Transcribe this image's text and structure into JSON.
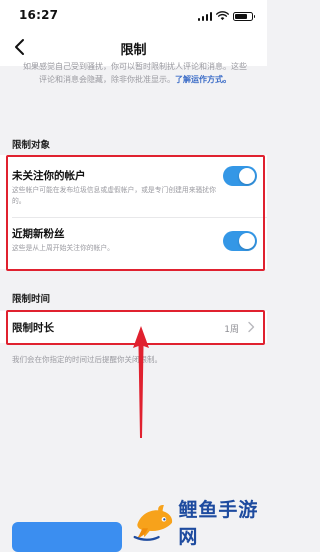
{
  "status_bar": {
    "time": "16:27"
  },
  "nav": {
    "title": "限制"
  },
  "intro": {
    "text": "如果感觉自己受到骚扰，你可以暂时限制扰人评论和消息。这些评论和消息会隐藏，除非你批准显示。",
    "link": "了解运作方式。"
  },
  "section_restrict_targets": {
    "header": "限制对象",
    "items": [
      {
        "title": "未关注你的帐户",
        "desc": "这些帐户可能在发布垃圾信息或虚假帐户，或是专门创建用来骚扰你的。",
        "enabled": true
      },
      {
        "title": "近期新粉丝",
        "desc": "这些是从上周开始关注你的帐户。",
        "enabled": true
      }
    ]
  },
  "section_restrict_time": {
    "header": "限制时间",
    "duration_label": "限制时长",
    "duration_value": "1周",
    "footnote": "我们会在你指定的时间过后提醒你关闭限制。"
  },
  "watermark": {
    "text": "鲤鱼手游网"
  },
  "colors": {
    "accent": "#3497e6",
    "highlight": "#e0212f",
    "link": "#3b6cc7"
  }
}
